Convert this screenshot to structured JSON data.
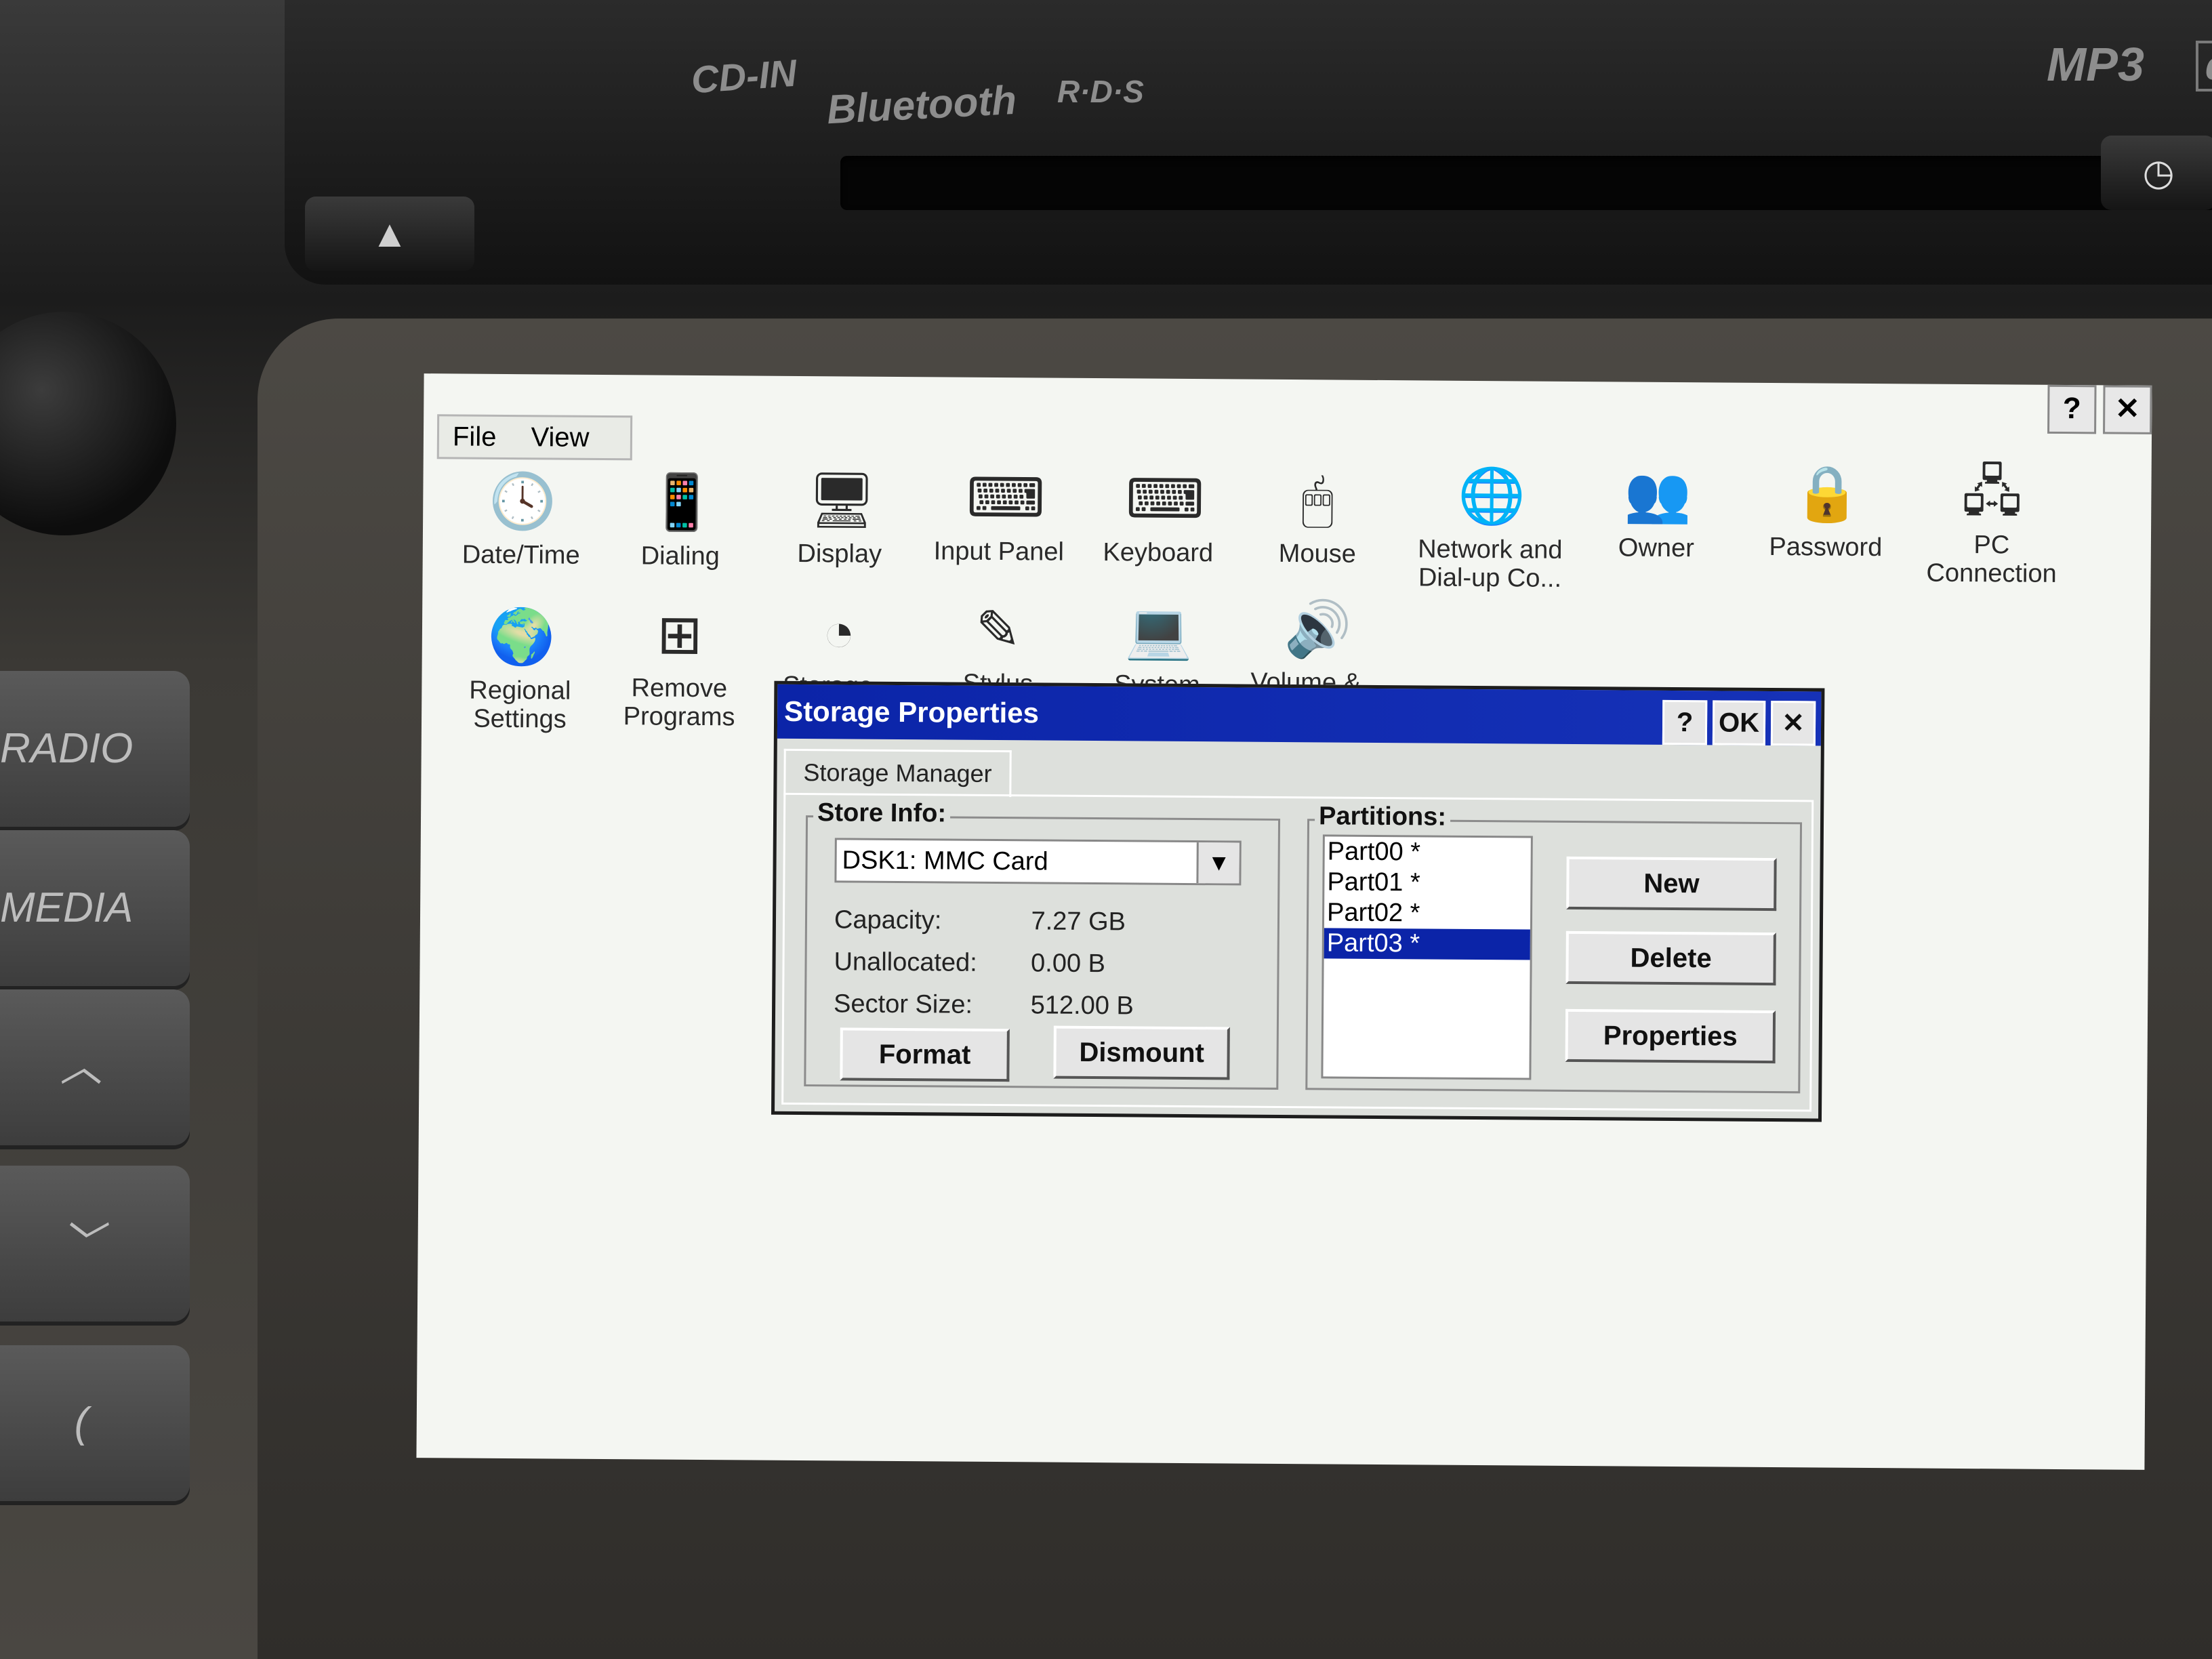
{
  "device": {
    "labels": {
      "cd_in": "CD-IN",
      "bluetooth": "Bluetooth",
      "rds": "R·D·S",
      "mp3": "MP3",
      "disc": "disc"
    },
    "side_buttons": [
      "RADIO",
      "MEDIA",
      "^",
      "v",
      "("
    ]
  },
  "window": {
    "title_buttons": {
      "help": "?",
      "close": "✕"
    },
    "menu": {
      "file": "File",
      "view": "View"
    }
  },
  "control_panel": {
    "items": [
      {
        "label": "Date/Time",
        "icon": "calendar-clock-icon"
      },
      {
        "label": "Dialing",
        "icon": "phone-icon"
      },
      {
        "label": "Display",
        "icon": "display-icon"
      },
      {
        "label": "Input Panel",
        "icon": "keyboard-panel-icon"
      },
      {
        "label": "Keyboard",
        "icon": "keyboard-icon"
      },
      {
        "label": "Mouse",
        "icon": "mouse-icon"
      },
      {
        "label": "Network and Dial-up Co...",
        "icon": "network-globe-icon"
      },
      {
        "label": "Owner",
        "icon": "owner-icon"
      },
      {
        "label": "Password",
        "icon": "padlock-icon"
      },
      {
        "label": "PC Connection",
        "icon": "pc-connection-icon"
      },
      {
        "label": "Regional Settings",
        "icon": "regional-globe-icon"
      },
      {
        "label": "Remove Programs",
        "icon": "windows-flag-icon"
      },
      {
        "label": "Storage...",
        "icon": "storage-icon"
      },
      {
        "label": "Stylus",
        "icon": "stylus-icon"
      },
      {
        "label": "System",
        "icon": "system-icon"
      },
      {
        "label": "Volume &...",
        "icon": "speaker-icon"
      }
    ]
  },
  "dialog": {
    "title": "Storage Properties",
    "buttons": {
      "help": "?",
      "ok": "OK",
      "close": "✕"
    },
    "tab": "Storage Manager",
    "store_info": {
      "label": "Store Info:",
      "selected_store": "DSK1: MMC Card",
      "capacity_label": "Capacity:",
      "capacity_value": "7.27 GB",
      "unallocated_label": "Unallocated:",
      "unallocated_value": "0.00 B",
      "sector_label": "Sector Size:",
      "sector_value": "512.00 B",
      "format_button": "Format",
      "dismount_button": "Dismount"
    },
    "partitions": {
      "label": "Partitions:",
      "items": [
        "Part00 *",
        "Part01 *",
        "Part02 *",
        "Part03 *"
      ],
      "selected_index": 3,
      "new_button": "New",
      "delete_button": "Delete",
      "properties_button": "Properties"
    }
  },
  "colors": {
    "title_bar": "#0b24a8",
    "selection": "#0b24a8",
    "dialog_bg": "#dde0dc",
    "screen_bg": "#f4f6f2"
  }
}
